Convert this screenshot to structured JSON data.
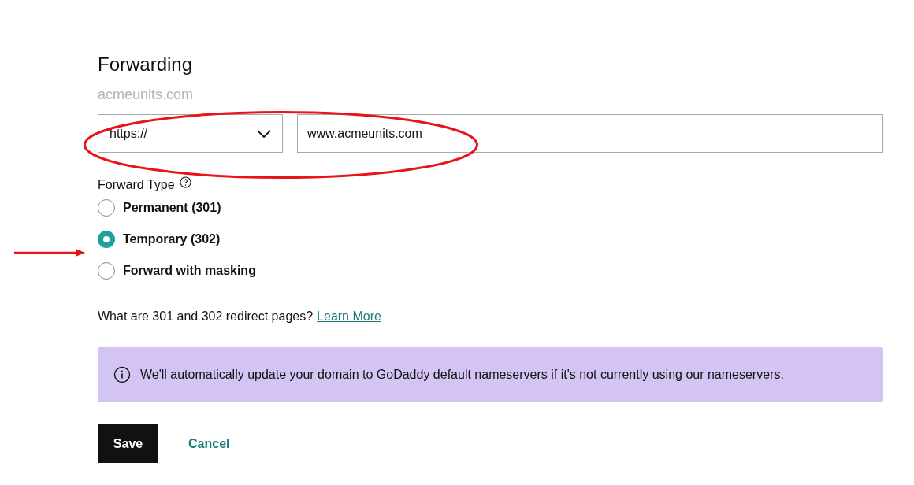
{
  "title": "Forwarding",
  "domain": "acmeunits.com",
  "protocol_select": {
    "value": "https://"
  },
  "destination_field": {
    "value": "www.acmeunits.com"
  },
  "forward_type": {
    "label": "Forward Type",
    "options": [
      {
        "label": "Permanent (301)",
        "selected": false
      },
      {
        "label": "Temporary (302)",
        "selected": true
      },
      {
        "label": "Forward with masking",
        "selected": false
      }
    ]
  },
  "help": {
    "text": "What are 301 and 302 redirect pages?",
    "link": "Learn More"
  },
  "notice": "We'll automatically update your domain to GoDaddy default nameservers if it's not currently using our nameservers.",
  "buttons": [
    {
      "label": "Save",
      "kind": "primary"
    },
    {
      "label": "Cancel",
      "kind": "link"
    }
  ]
}
